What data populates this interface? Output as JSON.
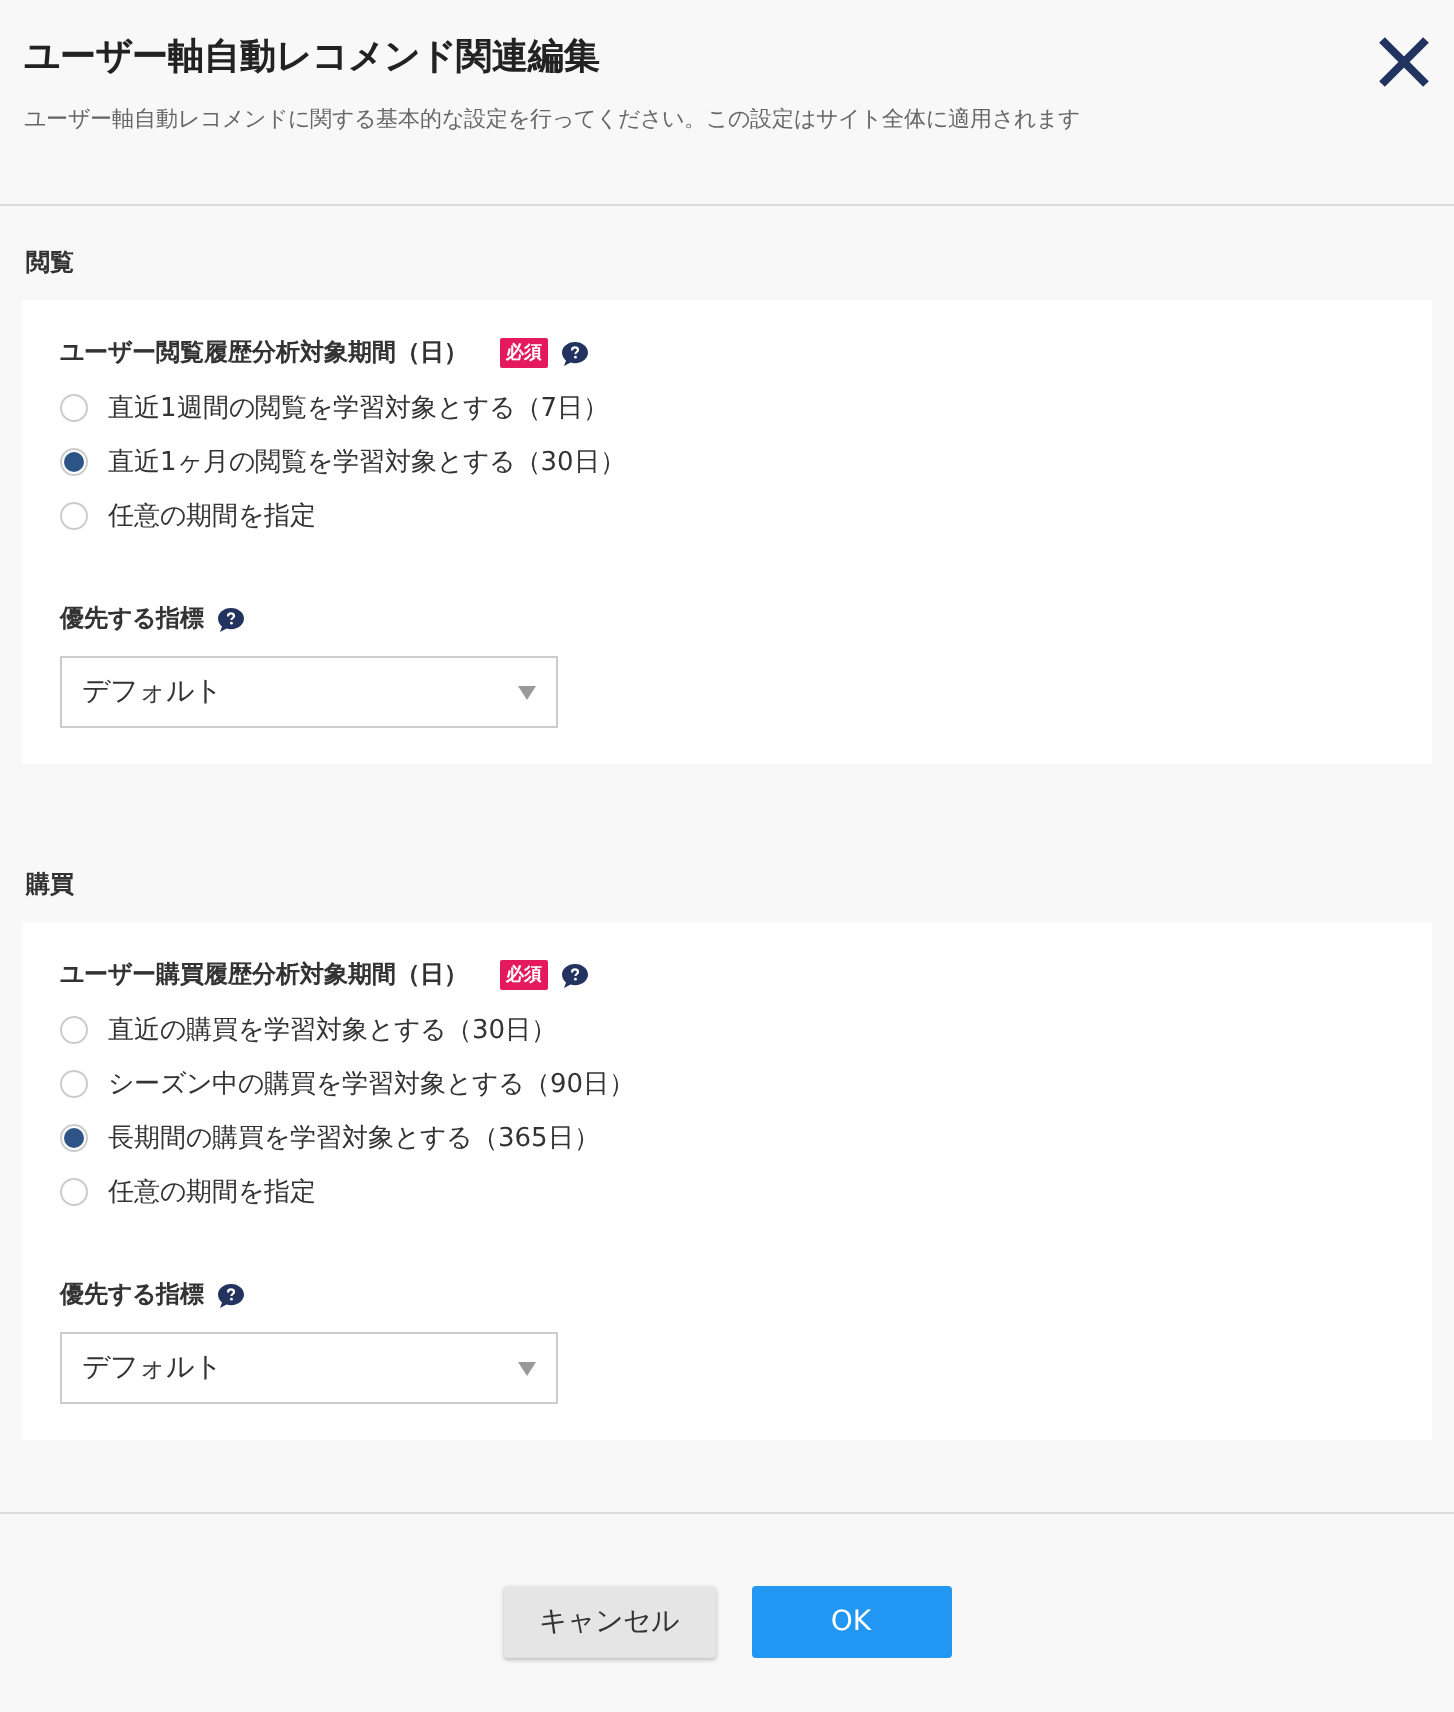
{
  "header": {
    "title": "ユーザー軸自動レコメンド関連編集",
    "description": "ユーザー軸自動レコメンドに関する基本的な設定を行ってください。この設定はサイト全体に適用されます"
  },
  "sections": [
    {
      "heading": "閲覧",
      "field_label": "ユーザー閲覧履歴分析対象期間（日）",
      "required_badge": "必須",
      "options": [
        {
          "label": "直近1週間の閲覧を学習対象とする（7日）",
          "selected": false
        },
        {
          "label": "直近1ヶ月の閲覧を学習対象とする（30日）",
          "selected": true
        },
        {
          "label": "任意の期間を指定",
          "selected": false
        }
      ],
      "metric_label": "優先する指標",
      "metric_value": "デフォルト"
    },
    {
      "heading": "購買",
      "field_label": "ユーザー購買履歴分析対象期間（日）",
      "required_badge": "必須",
      "options": [
        {
          "label": "直近の購買を学習対象とする（30日）",
          "selected": false
        },
        {
          "label": "シーズン中の購買を学習対象とする（90日）",
          "selected": false
        },
        {
          "label": "長期間の購買を学習対象とする（365日）",
          "selected": true
        },
        {
          "label": "任意の期間を指定",
          "selected": false
        }
      ],
      "metric_label": "優先する指標",
      "metric_value": "デフォルト"
    }
  ],
  "buttons": [
    {
      "label": "キャンセル",
      "kind": "secondary"
    },
    {
      "label": "OK",
      "kind": "primary"
    }
  ]
}
